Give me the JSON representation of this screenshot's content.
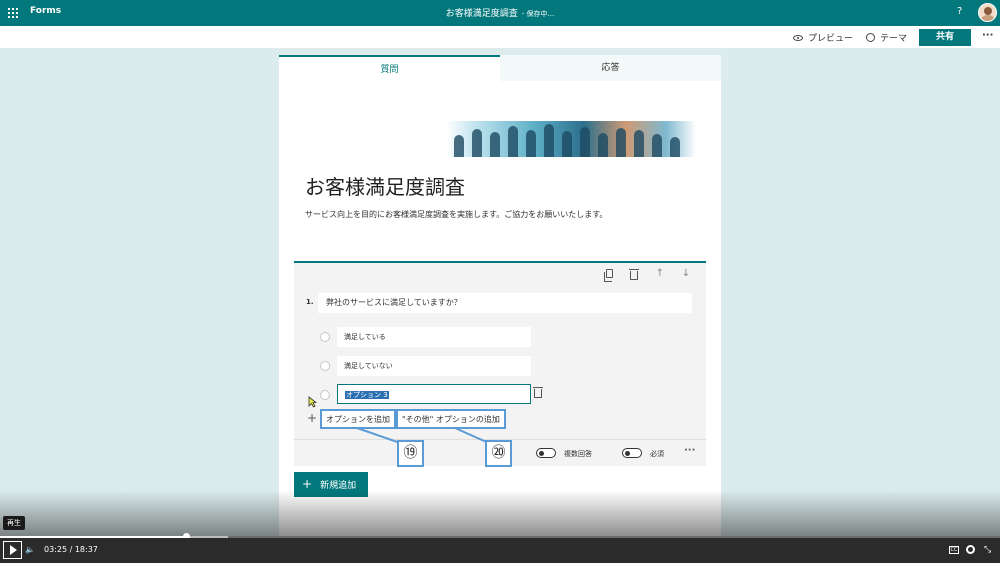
{
  "app": {
    "name": "Forms",
    "doc_title": "お客様満足度調査",
    "status": "- 保存中...",
    "help": "?"
  },
  "toolbar": {
    "preview": "プレビュー",
    "theme": "テーマ",
    "share": "共有",
    "more": "···"
  },
  "tabs": {
    "questions": "質問",
    "responses": "応答"
  },
  "form": {
    "title": "お客様満足度調査",
    "description": "サービス向上を目的にお客様満足度調査を実施します。ご協力をお願いいたします。"
  },
  "question": {
    "number": "1.",
    "text": "弊社のサービスに満足していますか？",
    "options": [
      "満足している",
      "満足していない"
    ],
    "editing_option": "オプション 3",
    "add_option": "オプションを追加",
    "add_other": "\"その他\" オプションの追加",
    "multiple_answers": "複数回答",
    "required": "必須",
    "more": "···"
  },
  "callouts": {
    "c19": "⑲",
    "c20": "⑳"
  },
  "new_item": {
    "plus": "+",
    "label": "新規追加"
  },
  "player": {
    "tooltip": "再生",
    "time": "03:25  /  18:37",
    "progress": 0.186,
    "cc": "CC"
  }
}
